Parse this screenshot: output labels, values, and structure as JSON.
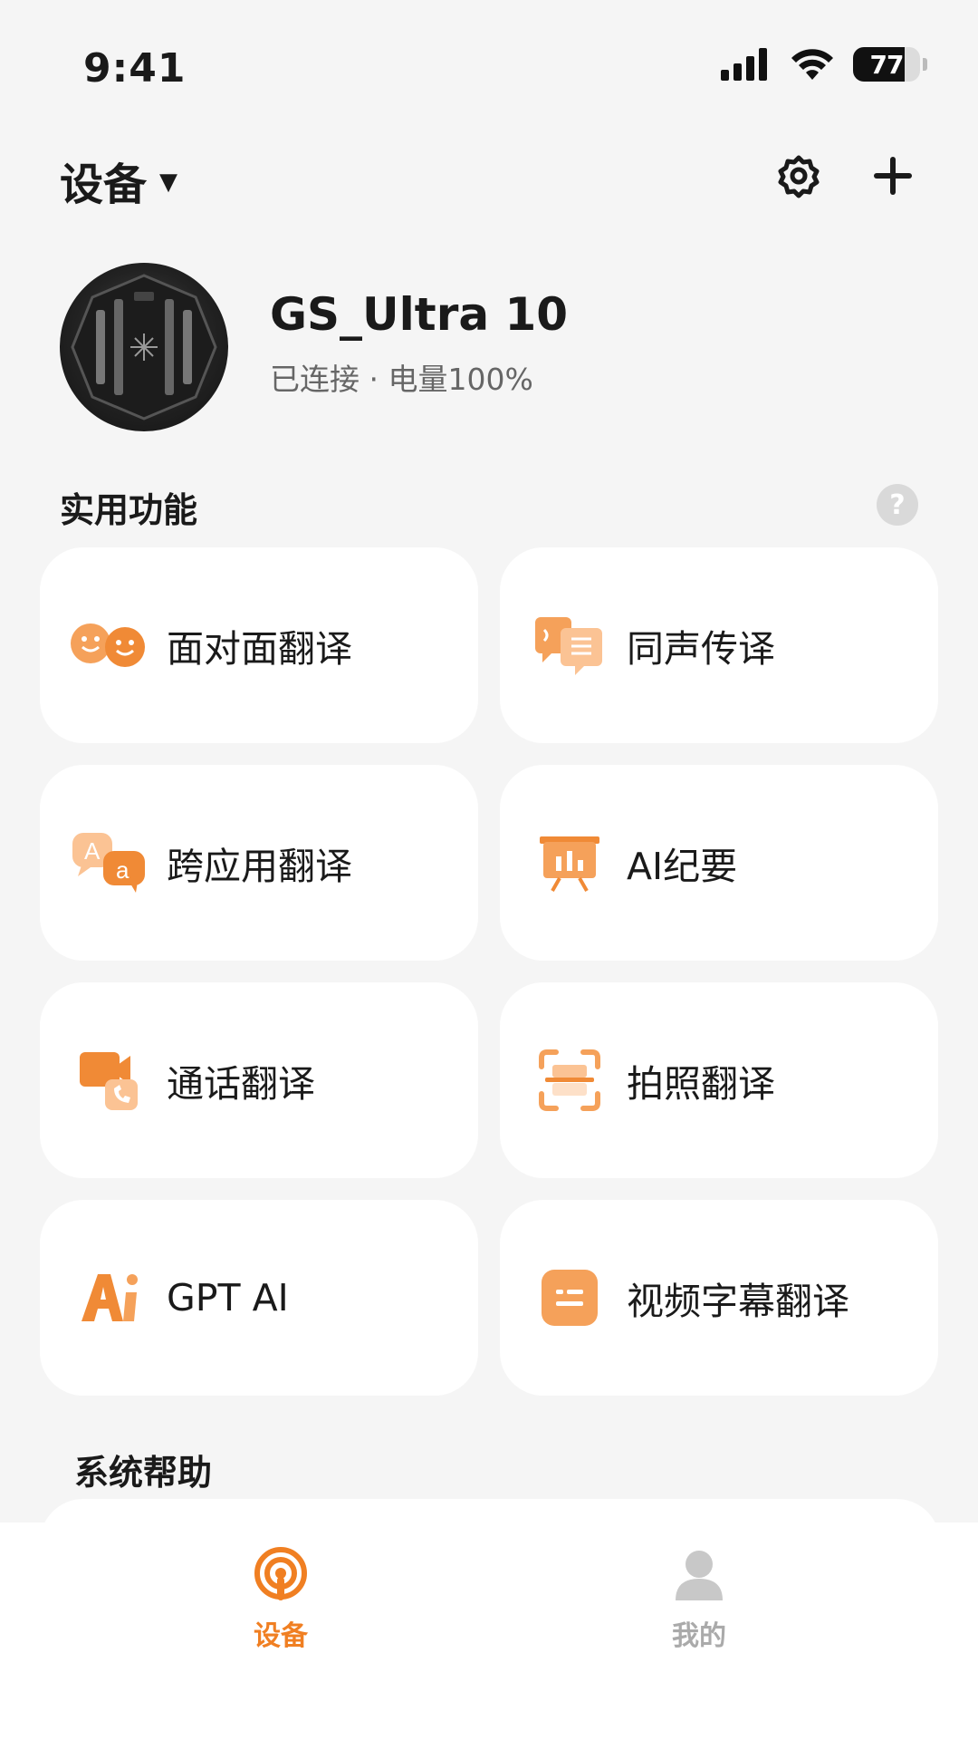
{
  "status_bar": {
    "time": "9:41",
    "battery_level": "77"
  },
  "header": {
    "title": "设备"
  },
  "device": {
    "name": "GS_Ultra 10",
    "status": "已连接 · 电量100%"
  },
  "sections": {
    "features_title": "实用功能",
    "help_title": "系统帮助",
    "help_icon": "?"
  },
  "features": [
    {
      "label": "面对面翻译",
      "icon": "face-to-face-icon"
    },
    {
      "label": "同声传译",
      "icon": "simultaneous-icon"
    },
    {
      "label": "跨应用翻译",
      "icon": "cross-app-icon"
    },
    {
      "label": "AI纪要",
      "icon": "presentation-icon"
    },
    {
      "label": "通话翻译",
      "icon": "call-icon"
    },
    {
      "label": "拍照翻译",
      "icon": "scan-icon"
    },
    {
      "label": "GPT AI",
      "icon": "ai-icon"
    },
    {
      "label": "视频字幕翻译",
      "icon": "subtitle-icon"
    }
  ],
  "tabs": [
    {
      "label": "设备",
      "active": true
    },
    {
      "label": "我的",
      "active": false
    }
  ],
  "colors": {
    "accent": "#f07f22",
    "accent_light": "#fbb37a",
    "background": "#f5f5f5"
  }
}
